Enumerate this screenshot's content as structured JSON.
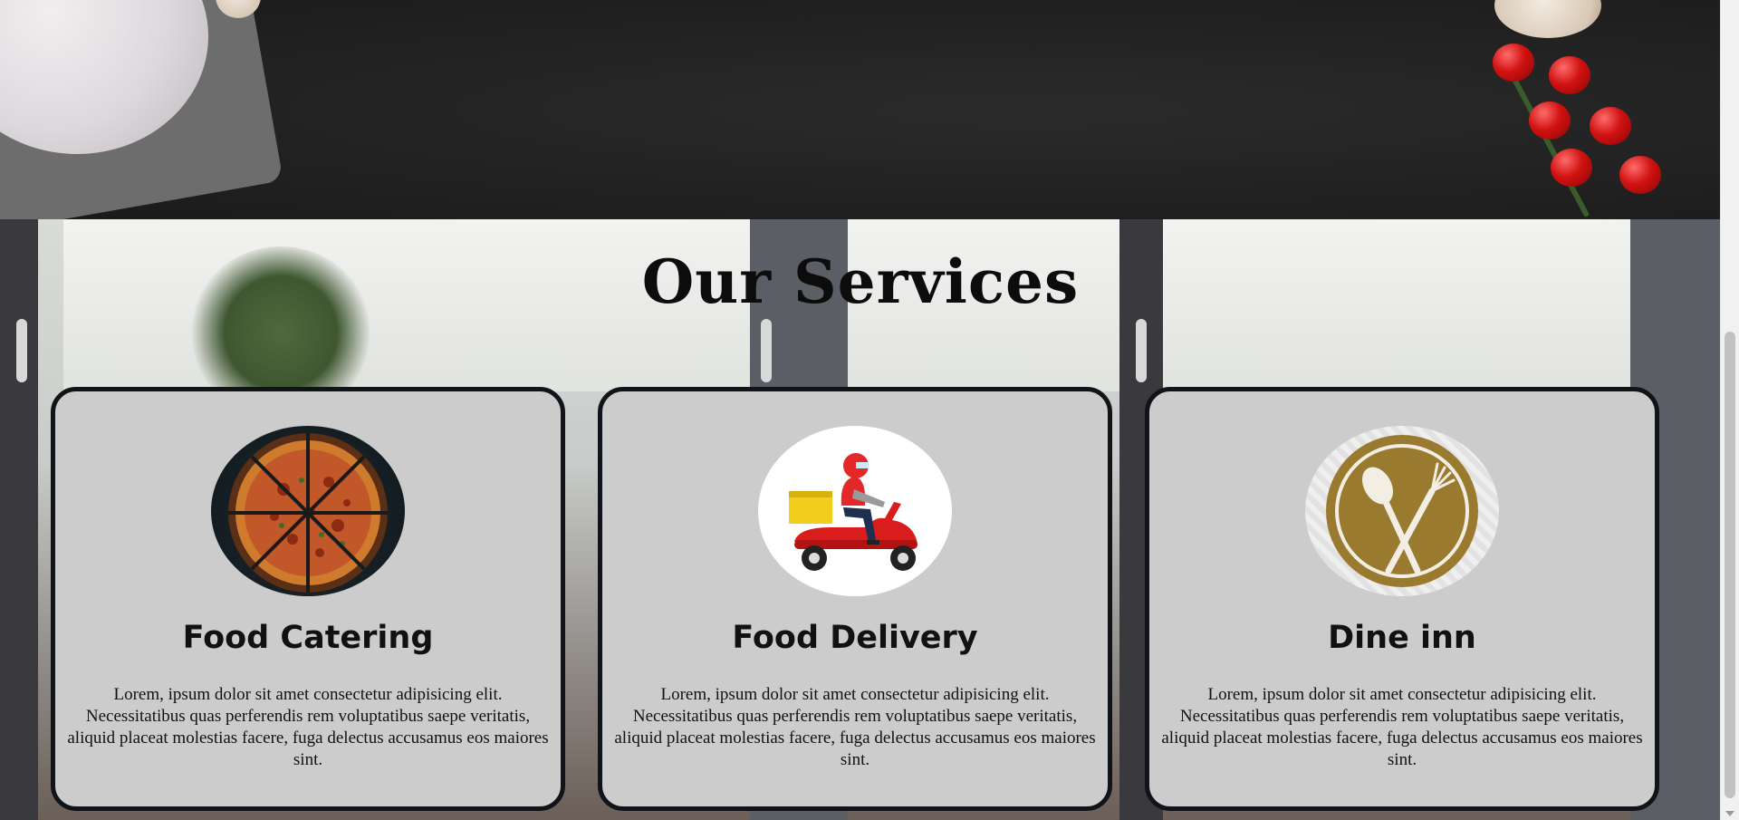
{
  "services": {
    "title": "Our Services",
    "cards": [
      {
        "title": "Food Catering",
        "description": "Lorem, ipsum dolor sit amet consectetur adipisicing elit. Necessitatibus quas perferendis rem voluptatibus saepe veritatis, aliquid placeat molestias facere, fuga delectus accusamus eos maiores sint.",
        "image": "pizza-image"
      },
      {
        "title": "Food Delivery",
        "description": "Lorem, ipsum dolor sit amet consectetur adipisicing elit. Necessitatibus quas perferendis rem voluptatibus saepe veritatis, aliquid placeat molestias facere, fuga delectus accusamus eos maiores sint.",
        "image": "scooter-delivery-image"
      },
      {
        "title": "Dine inn",
        "description": "Lorem, ipsum dolor sit amet consectetur adipisicing elit. Necessitatibus quas perferendis rem voluptatibus saepe veritatis, aliquid placeat molestias facere, fuga delectus accusamus eos maiores sint.",
        "image": "plate-fork-spoon-icon"
      }
    ]
  },
  "colors": {
    "card_background": "#cccccc",
    "card_border": "#101418",
    "dine_icon": "#9a7a2e",
    "scooter_red": "#d91c1c",
    "delivery_box": "#f2cd1e"
  }
}
